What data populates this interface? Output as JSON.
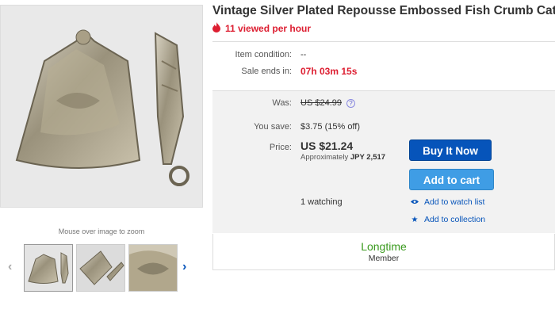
{
  "listing": {
    "title": "Vintage Silver Plated Repousse Embossed Fish Crumb Catcher",
    "viewed": "11 viewed per hour"
  },
  "gallery": {
    "zoom_hint": "Mouse over image to zoom"
  },
  "details": {
    "condition_label": "Item condition:",
    "condition_value": "--",
    "sale_label": "Sale ends in:",
    "sale_value": "07h 03m 15s"
  },
  "pricing": {
    "was_label": "Was:",
    "was_value": "US $24.99",
    "save_label": "You save:",
    "save_value": "$3.75 (15% off)",
    "price_label": "Price:",
    "price_value": "US $21.24",
    "approx_prefix": "Approximately",
    "approx_value": "JPY 2,517",
    "watching": "1 watching"
  },
  "actions": {
    "buy_now": "Buy It Now",
    "add_to_cart": "Add to cart",
    "watch_list": "Add to watch list",
    "collection": "Add to collection"
  },
  "seller": {
    "badge": "Longtime",
    "status": "Member"
  },
  "colors": {
    "accent": "#0654ba",
    "cart": "#3f9de5",
    "alert": "#dd1e31",
    "badge": "#3a9a1e"
  },
  "icons": {
    "viewed": "flame-icon",
    "info": "info-icon",
    "watch": "eye-icon",
    "collection": "star-icon",
    "prev": "chevron-left-icon",
    "next": "chevron-right-icon"
  }
}
